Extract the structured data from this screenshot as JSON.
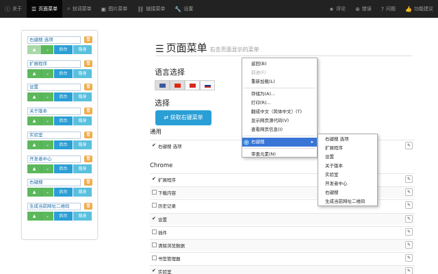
{
  "nav": {
    "left": [
      {
        "icon": "info-icon",
        "glyph": "ⓘ",
        "label": "关于",
        "active": false
      },
      {
        "icon": "list-icon",
        "glyph": "☰",
        "label": "页面菜单",
        "active": true
      },
      {
        "icon": "search-icon",
        "glyph": "⌕",
        "label": "划词菜单",
        "active": false
      },
      {
        "icon": "image-icon",
        "glyph": "▣",
        "label": "图片菜单",
        "active": false
      },
      {
        "icon": "link-icon",
        "glyph": "⛓",
        "label": "链接菜单",
        "active": false
      },
      {
        "icon": "wrench-icon",
        "glyph": "🔧",
        "label": "设置",
        "active": false
      }
    ],
    "right": [
      {
        "icon": "star-icon",
        "glyph": "★",
        "label": "评论"
      },
      {
        "icon": "plus-circle-icon",
        "glyph": "⊕",
        "label": "错误"
      },
      {
        "icon": "question-circle-icon",
        "glyph": "?",
        "label": "问题"
      },
      {
        "icon": "thumbs-up-icon",
        "glyph": "👍",
        "label": "功能建议"
      }
    ]
  },
  "left_panel": {
    "items": [
      {
        "label": "右键搜 选项",
        "up_disabled": true
      },
      {
        "label": "扩展程序",
        "up_disabled": false
      },
      {
        "label": "设置",
        "up_disabled": false
      },
      {
        "label": "关于版本",
        "up_disabled": false
      },
      {
        "label": "实验室",
        "up_disabled": false
      },
      {
        "label": "开发者中心",
        "up_disabled": false
      },
      {
        "label": "右键搜",
        "up_disabled": false
      },
      {
        "label": "生成当前网址二维码",
        "up_disabled": false
      }
    ],
    "back_label": "后台",
    "hide_label": "隐身",
    "up_glyph": "▲",
    "down_glyph": "⌄",
    "trash_glyph": "🗑"
  },
  "main": {
    "title": "页面菜单",
    "subtitle": "右击页面显示的菜单",
    "lang_heading": "语言选择",
    "flags": [
      {
        "icon": "us-flag-icon",
        "color": "#3c5a99",
        "selected": true
      },
      {
        "icon": "cn-flag-icon",
        "color": "#de2910",
        "selected": true
      },
      {
        "icon": "tw-flag-icon",
        "color": "#d52b1e",
        "selected": false
      },
      {
        "icon": "ru-flag-icon",
        "color": "#d52b1e",
        "selected": false
      }
    ],
    "choose_heading": "选择",
    "fetch_button": "⇄ 获取右键菜单",
    "section_common": "通用",
    "common_rows": [
      {
        "label": "右键搜 选项",
        "checked": true
      }
    ],
    "section_chrome": "Chrome",
    "chrome_rows": [
      {
        "label": "扩展程序",
        "checked": true
      },
      {
        "label": "下载内容",
        "checked": false
      },
      {
        "label": "历史记录",
        "checked": false
      },
      {
        "label": "设置",
        "checked": true
      },
      {
        "label": "插件",
        "checked": false
      },
      {
        "label": "清除浏览数据",
        "checked": false
      },
      {
        "label": "书签管理器",
        "checked": false
      },
      {
        "label": "实验室",
        "checked": true
      }
    ]
  },
  "context_menu": {
    "items": [
      {
        "label": "返回(B)",
        "disabled": false
      },
      {
        "label": "前进(F)",
        "disabled": true
      },
      {
        "label": "重新加载(L)",
        "disabled": false
      },
      {
        "sep": true
      },
      {
        "label": "存储为(A)...",
        "disabled": false
      },
      {
        "label": "打印(R)...",
        "disabled": false
      },
      {
        "label": "翻成中文（简体中文）(T)",
        "disabled": false
      },
      {
        "label": "显示网页源代码(V)",
        "disabled": false
      },
      {
        "label": "查看网页信息(I)",
        "disabled": false
      },
      {
        "sep": true
      },
      {
        "label": "右键搜",
        "highlight": true,
        "has_sub": true,
        "icon": "search-ext-icon"
      },
      {
        "sep": true
      },
      {
        "label": "审查元素(N)",
        "disabled": false
      }
    ],
    "submenu": [
      "右键搜 选项",
      "扩展程序",
      "设置",
      "关于版本",
      "实验室",
      "开发者中心",
      "右键搜",
      "生成当前网址二维码"
    ]
  },
  "colors": {
    "navbar": "#222222",
    "primary": "#2a9fd6",
    "success": "#5cb85c",
    "info": "#5bc0de",
    "warning": "#f0ad4e",
    "highlight": "#3875d7"
  }
}
